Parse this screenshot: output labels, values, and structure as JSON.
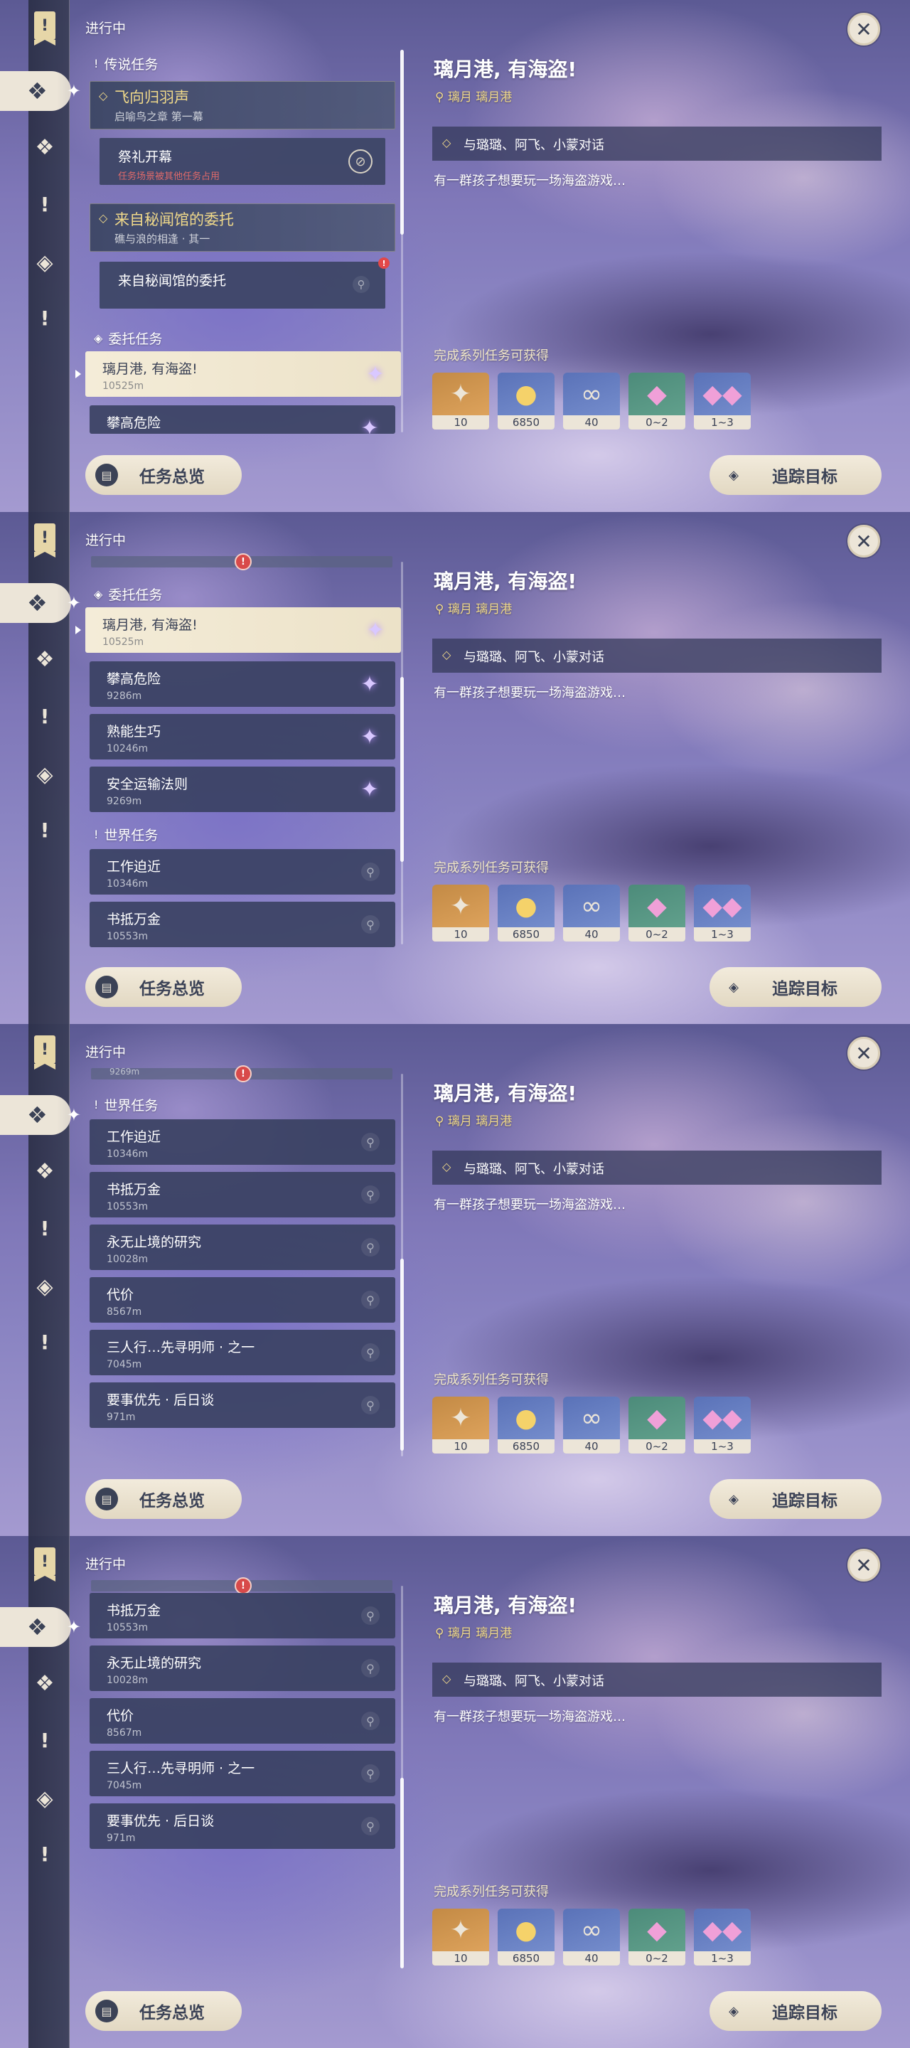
{
  "header": {
    "section": "进行中"
  },
  "categories": {
    "legend": "传说任务",
    "commission": "委托任务",
    "world": "世界任务"
  },
  "legend_quests": [
    {
      "name": "飞向归羽声",
      "desc": "启喻鸟之章 第一幕",
      "sub": {
        "name": "祭礼开幕",
        "desc": "任务场景被其他任务占用"
      }
    },
    {
      "name": "来自秘闻馆的委托",
      "desc": "礁与浪的相逢 · 其一",
      "sub": {
        "name": "来自秘闻馆的委托",
        "badge": "!"
      }
    }
  ],
  "commissions": [
    {
      "name": "璃月港, 有海盗!",
      "dist": "10525m"
    },
    {
      "name": "攀高危险",
      "dist": "9286m"
    },
    {
      "name": "熟能生巧",
      "dist": "10246m"
    },
    {
      "name": "安全运输法则",
      "dist": "9269m"
    }
  ],
  "world_quests": [
    {
      "name": "工作迫近",
      "dist": "10346m"
    },
    {
      "name": "书抵万金",
      "dist": "10553m"
    },
    {
      "name": "永无止境的研究",
      "dist": "10028m"
    },
    {
      "name": "代价",
      "dist": "8567m"
    },
    {
      "name": "三人行…先寻明师 · 之一",
      "dist": "7045m"
    },
    {
      "name": "要事优先 · 后日谈",
      "dist": "971m"
    }
  ],
  "partial_dist": "9269m",
  "alert_badge": "!",
  "buttons": {
    "overview": "任务总览",
    "track": "追踪目标",
    "close": "✕"
  },
  "detail": {
    "title": "璃月港, 有海盗!",
    "location": "璃月 璃月港",
    "objective": "与璐璐、阿飞、小蒙对话",
    "description": "有一群孩子想要玩一场海盗游戏…",
    "rewards_label": "完成系列任务可获得",
    "rewards": [
      {
        "icon": "primogem-icon",
        "count": "10"
      },
      {
        "icon": "mora-icon",
        "count": "6850"
      },
      {
        "icon": "friendship-exp-icon",
        "count": "40"
      },
      {
        "icon": "crystal-ore-icon",
        "count": "0~2"
      },
      {
        "icon": "crystal-chunk-icon",
        "count": "1~3"
      }
    ]
  }
}
